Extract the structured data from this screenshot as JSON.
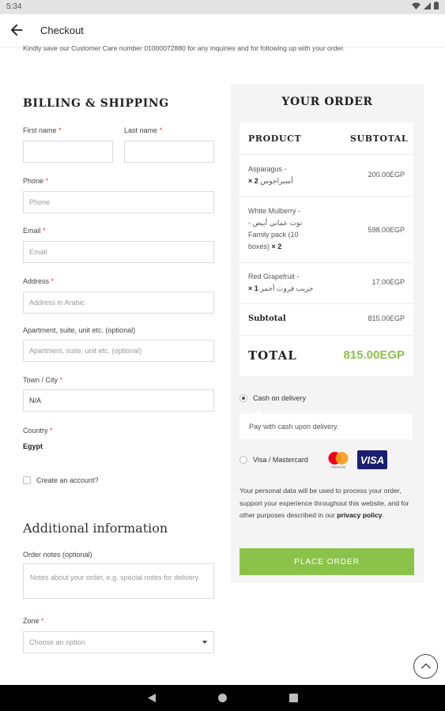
{
  "status_bar": {
    "time": "5:34"
  },
  "app_bar": {
    "title": "Checkout"
  },
  "notice": "Kindly save our Customer Care number 01000072880 for any inquiries and for following up with your order.",
  "billing": {
    "heading": "BILLING & SHIPPING",
    "required_mark": "*",
    "first_name": {
      "label": "First name",
      "value": ""
    },
    "last_name": {
      "label": "Last name",
      "value": ""
    },
    "phone": {
      "label": "Phone",
      "placeholder": "Phone"
    },
    "email": {
      "label": "Email",
      "placeholder": "Email"
    },
    "address": {
      "label": "Address",
      "placeholder": "Address in Arabic"
    },
    "apartment": {
      "label": "Apartment, suite, unit etc. (optional)",
      "placeholder": "Apartment, suite, unit etc. (optional)"
    },
    "town": {
      "label": "Town / City",
      "value": "N/A"
    },
    "country": {
      "label": "Country",
      "value": "Egypt"
    },
    "create_account": {
      "label": "Create an account?",
      "checked": false
    }
  },
  "additional": {
    "heading": "Additional information",
    "order_notes": {
      "label": "Order notes (optional)",
      "placeholder": "Notes about your order, e.g. special notes for delivery."
    },
    "zone": {
      "label": "Zone",
      "placeholder": "Choose an option"
    }
  },
  "order": {
    "heading": "YOUR ORDER",
    "col_product": "PRODUCT",
    "col_subtotal": "SUBTOTAL",
    "items": [
      {
        "name_line1": "Asparagus -",
        "name_line2": "أسبراجوس",
        "qty": "× 2",
        "price": "200.00EGP"
      },
      {
        "name_line1": "White Mulberry -",
        "name_line2": "- توت عماني أبيض",
        "name_line3": "Family pack (10",
        "name_line4": "boxes)",
        "qty": "× 2",
        "price": "598.00EGP"
      },
      {
        "name_line1": "Red Grapefruit -",
        "name_line2": "جريب فروت أحمر",
        "qty": "× 1",
        "price": "17.00EGP"
      }
    ],
    "subtotal_label": "Subtotal",
    "subtotal_value": "815.00EGP",
    "total_label": "TOTAL",
    "total_value": "815.00EGP"
  },
  "payment": {
    "cod_label": "Cash on delivery",
    "cod_selected": true,
    "cod_description": "Pay with cash upon delivery.",
    "card_label": "Visa / Mastercard",
    "card_selected": false,
    "mastercard_caption": "mastercard",
    "visa_logo_text": "VISA"
  },
  "privacy": {
    "text": "Your personal data will be used to process your order, support your experience throughout this website, and for other purposes described in our",
    "link": "privacy policy"
  },
  "place_order_label": "PLACE ORDER",
  "colors": {
    "accent_green": "#8bc34a",
    "required_red": "#e53935",
    "visa_blue": "#1a1f71"
  },
  "icons": [
    "back-arrow-icon",
    "wifi-icon",
    "signal-icon",
    "battery-icon",
    "chevron-up-icon",
    "nav-back-icon",
    "nav-home-icon",
    "nav-recents-icon",
    "dropdown-caret-icon"
  ]
}
